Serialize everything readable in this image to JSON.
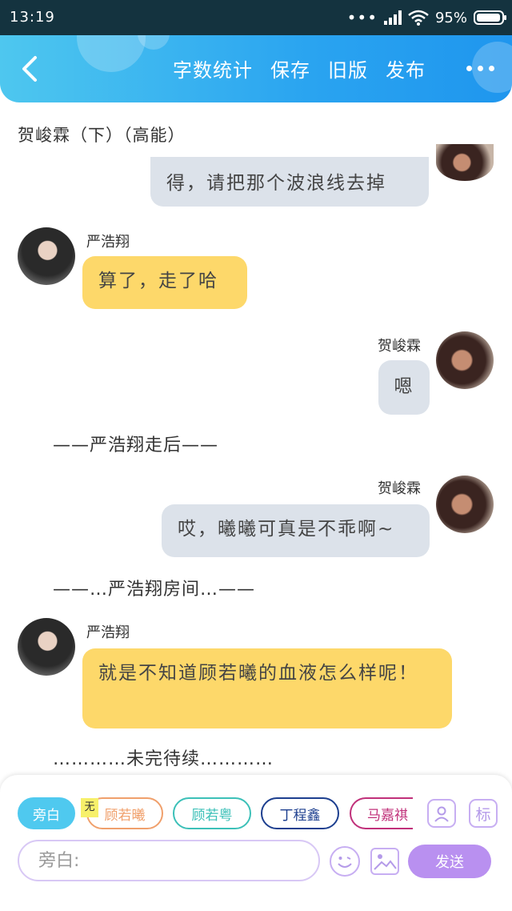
{
  "status_bar": {
    "time": "13:19",
    "dots": "•••",
    "battery_percent": "95%",
    "battery_level": 0.95
  },
  "header": {
    "back_icon": "chevron-left-icon",
    "actions": [
      "字数统计",
      "保存",
      "旧版",
      "发布"
    ],
    "more_icon": "more-dots-icon",
    "color_start": "#4ec7ef",
    "color_end": "#1f96ee"
  },
  "chat_title": "贺峻霖（下）（高能）",
  "messages": [
    {
      "speaker": "",
      "text": "得，请把那个波浪线去掉"
    },
    {
      "speaker": "严浩翔",
      "text": "算了，走了哈"
    },
    {
      "speaker": "贺峻霖",
      "text": "嗯"
    },
    {
      "narration": "——严浩翔走后——"
    },
    {
      "speaker": "贺峻霖",
      "text": "哎，曦曦可真是不乖啊~"
    },
    {
      "narration": "——…严浩翔房间…——"
    },
    {
      "speaker": "严浩翔",
      "text": "就是不知道顾若曦的血液怎么样呢！"
    },
    {
      "narration": "…………未完待续…………"
    }
  ],
  "bottom": {
    "chips": [
      "旁白",
      "顾若曦",
      "顾若粤",
      "丁程鑫",
      "马嘉祺"
    ],
    "chip_colors": [
      "#4fc9ef",
      "#f0a06c",
      "#3cc0b8",
      "#1d3f8f",
      "#c0307a"
    ],
    "tag_mini": "无",
    "tool_icons": [
      "person-card-icon",
      "tag-icon"
    ],
    "tool_tag_label": "标",
    "input_placeholder": "旁白:",
    "emoji_icon": "smile-icon",
    "image_icon": "image-icon",
    "send_label": "发送",
    "accent": "#b990f0"
  }
}
